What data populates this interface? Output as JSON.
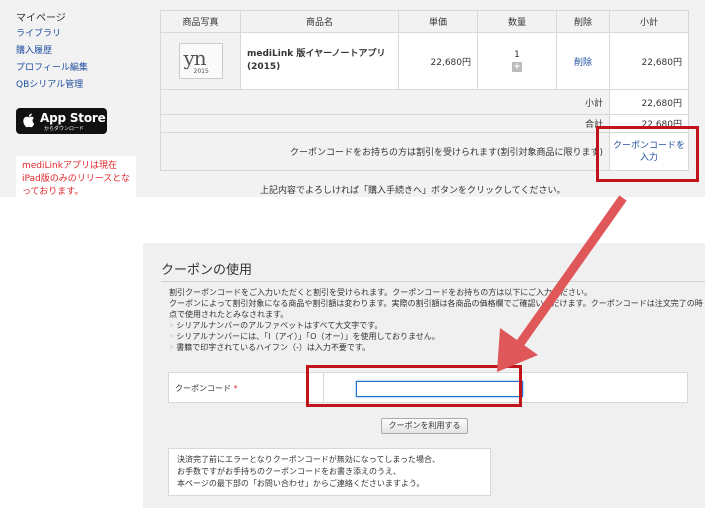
{
  "sidebar": {
    "title": "マイページ",
    "links": [
      "ライブラリ",
      "購入履歴",
      "プロフィール編集",
      "QBシリアル管理"
    ],
    "appstore_line1": "App Store",
    "appstore_line2": "からダウンロード",
    "notice": "mediLinkアプリは現在iPad版のみのリリースとなっております。"
  },
  "cart": {
    "headers": [
      "商品写真",
      "商品名",
      "単価",
      "数量",
      "削除",
      "小計"
    ],
    "item": {
      "thumb_text": "yn",
      "thumb_year": "2015",
      "name": "mediLink 版イヤーノートアプリ(2015)",
      "unit_price": "22,680円",
      "qty": "1",
      "qty_plus": "+",
      "delete": "削除",
      "subtotal": "22,680円"
    },
    "subtotal_label": "小計",
    "subtotal_value": "22,680円",
    "total_label": "合計",
    "total_value": "22,680円",
    "coupon_notice": "クーポンコードをお持ちの方は割引を受けられます(割引対象商品に限ります)",
    "coupon_link": "クーポンコードを入力",
    "confirm_text": "上記内容でよろしければ「購入手続きへ」ボタンをクリックしてください。"
  },
  "coupon_panel": {
    "title": "クーポンの使用",
    "desc1": "割引クーポンコードをご入力いただくと割引を受けられます。クーポンコードをお持ちの方は以下にご入力ください。",
    "desc2": "クーポンによって割引対象になる商品や割引額は変わります。実際の割引額は各商品の価格欄でご確認いただけます。クーポンコードは注文完了の時点で使用されたとみなされます。",
    "bullets": [
      "シリアルナンバーのアルファベットはすべて大文字です。",
      "シリアルナンバーには、「I（アイ）」「O（オー）」を使用しておりません。",
      "書籍で印字されているハイフン（-）は入力不要です。"
    ],
    "field_label": "クーポンコード",
    "required_mark": "*",
    "input_value": "",
    "apply_button": "クーポンを利用する",
    "note": [
      "決済完了前にエラーとなりクーポンコードが無効になってしまった場合、",
      "お手数ですがお手持ちのクーポンコードをお書き添えのうえ、",
      "本ページの最下部の「お問い合わせ」からご連絡くださいますよう。"
    ]
  },
  "colors": {
    "highlight": "#c0131a",
    "arrow": "#e0575a",
    "link": "#1f4fa0",
    "notice": "#e0262d"
  }
}
